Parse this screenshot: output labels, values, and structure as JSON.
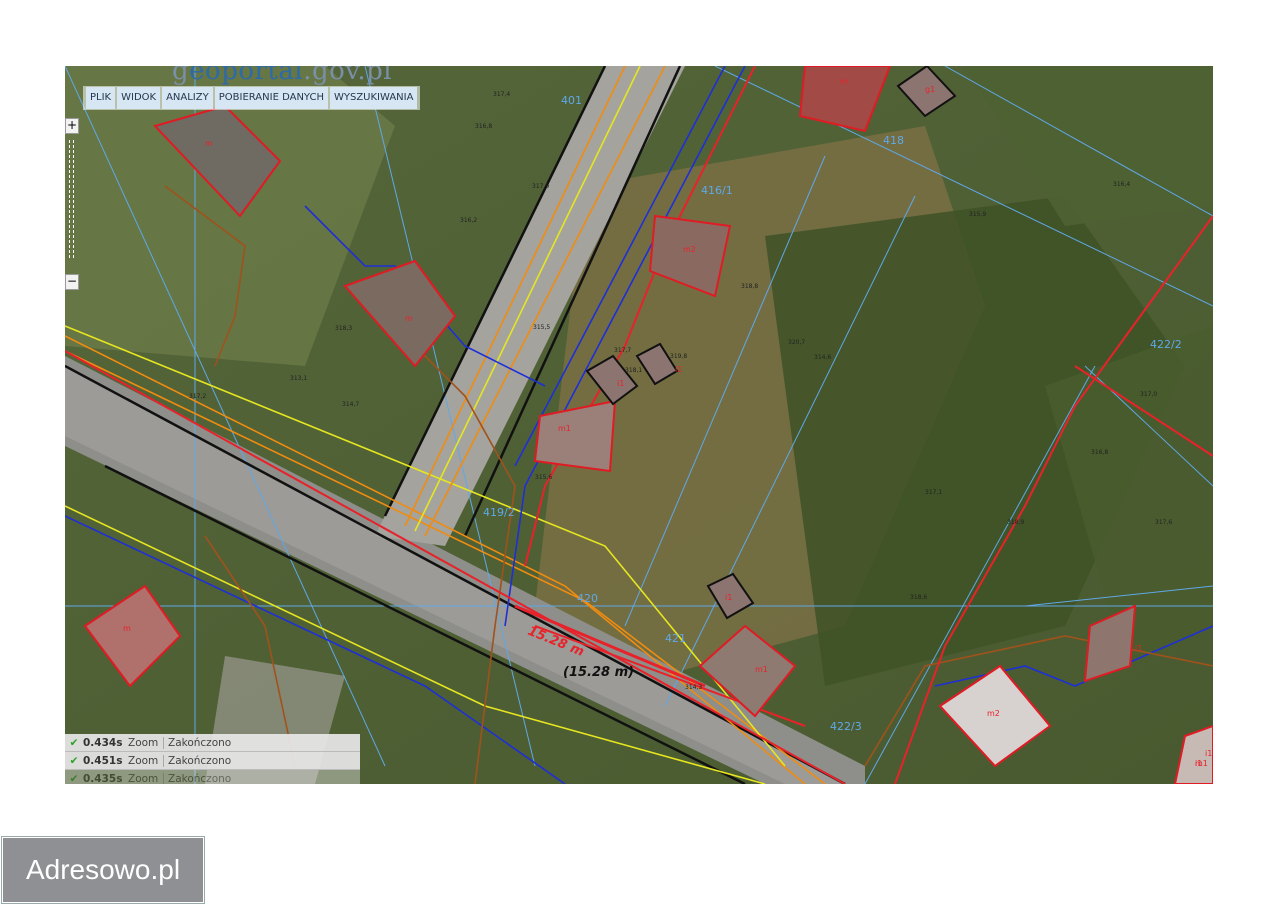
{
  "portal": {
    "logo_prefix": "g",
    "logo_accent": "eoportal",
    "logo_suffix": ".gov.pl"
  },
  "menu": [
    "PLIK",
    "WIDOK",
    "ANALIZY",
    "POBIERANIE DANYCH",
    "WYSZUKIWANIA"
  ],
  "zoom": {
    "plus": "+",
    "minus": "−"
  },
  "log": [
    {
      "time": "0.434s",
      "action": "Zoom",
      "status": "Zakończono"
    },
    {
      "time": "0.451s",
      "action": "Zoom",
      "status": "Zakończono"
    },
    {
      "time": "0.435s",
      "action": "Zoom",
      "status": "Zakończono"
    }
  ],
  "measure": {
    "value": "15.28 m",
    "value_paren": "(15.28 m)"
  },
  "parcels": [
    "401",
    "418",
    "416/1",
    "422/2",
    "420",
    "421",
    "422/3",
    "419/2"
  ],
  "building_codes": [
    "m",
    "m",
    "m",
    "m",
    "m1",
    "m1",
    "m1",
    "m2",
    "m2",
    "i1",
    "i1",
    "i1",
    "i1",
    "i1",
    "g1",
    "i1"
  ],
  "heights": [
    "317,4",
    "316,8",
    "317,0",
    "316,2",
    "318,3",
    "315,5",
    "317,7",
    "319,8",
    "320,7",
    "315,6",
    "318,1",
    "318,8",
    "314,6",
    "315,9",
    "316,4",
    "317,1",
    "316,8",
    "317,6",
    "318,5",
    "317,0",
    "318,6",
    "318,9",
    "314,3",
    "313,1",
    "314,7",
    "317,2"
  ],
  "brand": "Adresowo.pl",
  "colors": {
    "gas": "#e8222a",
    "water": "#1e2fd8",
    "sewer": "#a0521c",
    "power": "#f08c10",
    "telecom": "#e6e620",
    "parcel": "#5fa8e8",
    "road": "#111111"
  }
}
